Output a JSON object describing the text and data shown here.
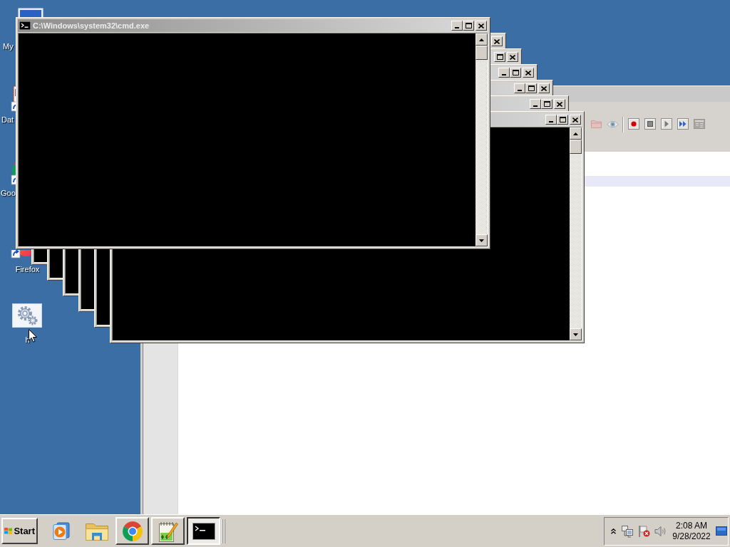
{
  "desktop_icons": [
    {
      "label": "My",
      "kind": "computer",
      "selected": false
    },
    {
      "label": "Dat",
      "kind": "shortcut",
      "selected": false
    },
    {
      "label": "Goo",
      "kind": "round-shortcut",
      "selected": false
    },
    {
      "label": "Firefox",
      "kind": "globe-shortcut",
      "selected": false
    },
    {
      "label": "h",
      "kind": "settings",
      "selected": true
    }
  ],
  "app_window": {
    "toolbar": [
      {
        "kind": "folder",
        "disabled": true
      },
      {
        "kind": "eye",
        "disabled": true
      },
      {
        "kind": "separator"
      },
      {
        "kind": "record",
        "disabled": false
      },
      {
        "kind": "stop",
        "disabled": false
      },
      {
        "kind": "play",
        "disabled": false
      },
      {
        "kind": "fast-forward",
        "disabled": false
      },
      {
        "kind": "window-list",
        "disabled": true
      }
    ]
  },
  "console_windows": [
    {
      "kind": "console",
      "title": "C:\\Windows\\system32\\cmd.exe"
    },
    {
      "kind": "console"
    },
    {
      "kind": "console"
    },
    {
      "kind": "console"
    },
    {
      "kind": "console"
    },
    {
      "kind": "console"
    },
    {
      "kind": "console"
    }
  ],
  "taskbar": {
    "start_label": "Start",
    "buttons": [
      {
        "kind": "media-player",
        "running": false,
        "selected": false
      },
      {
        "kind": "folder",
        "running": false,
        "selected": false
      },
      {
        "kind": "browser",
        "running": true,
        "selected": false
      },
      {
        "kind": "notepad",
        "running": true,
        "selected": false
      },
      {
        "kind": "console",
        "running": true,
        "selected": true
      }
    ],
    "tray": {
      "time": "2:08 AM",
      "date": "9/28/2022"
    }
  }
}
